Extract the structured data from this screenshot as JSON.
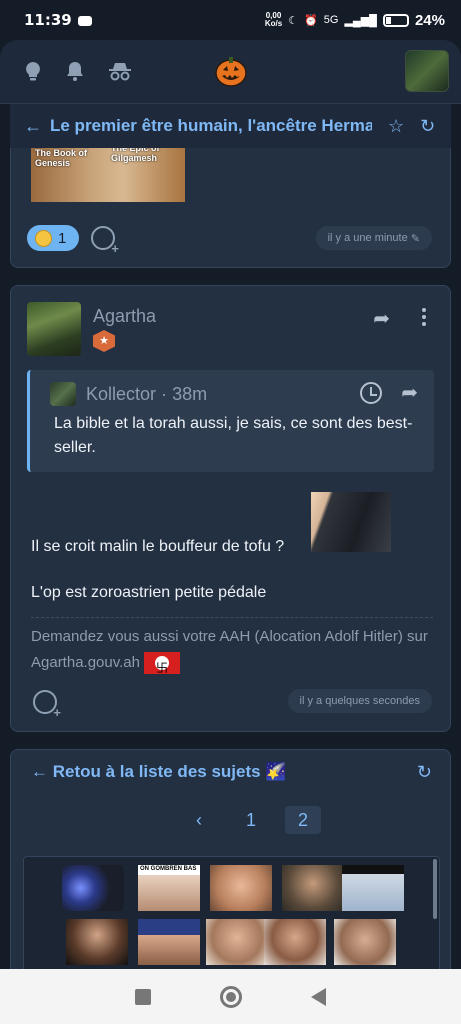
{
  "status_bar": {
    "time": "11:39",
    "net_speed_top": "0,00",
    "net_speed_unit": "Ko/s",
    "network": "5G",
    "battery": "24%"
  },
  "topic": {
    "title": "Le premier être humain, l'ancêtre Hermap"
  },
  "post1": {
    "image_caption_left": "The Book of Genesis",
    "image_caption_right": "The Epic of Gilgamesh",
    "reaction_count": "1",
    "time": "il y a une minute"
  },
  "post2": {
    "author": "Agartha",
    "quote": {
      "author": "Kollector",
      "separator": "·",
      "age": "38m",
      "text": "La bible et la torah aussi, je sais, ce sont des best-seller."
    },
    "line1": "Il se croit malin le bouffeur de tofu ?",
    "line2": "L'op est zoroastrien petite pédale",
    "signature": "Demandez vous aussi votre AAH (Alocation Adolf Hitler) sur Agartha.gouv.ah",
    "time": "il y a quelques secondes"
  },
  "topic_nav": {
    "back_label": "Retou à la liste des sujets 🌠",
    "pages": [
      "1",
      "2"
    ],
    "current_page": "2",
    "prev_symbol": "‹"
  },
  "sticker_grid": {
    "banner_text": "ON GOMBREN BAS"
  },
  "colors": {
    "accent": "#7fb8f5",
    "card": "#233042",
    "background": "#141c28",
    "badge": "#d96b3a"
  }
}
